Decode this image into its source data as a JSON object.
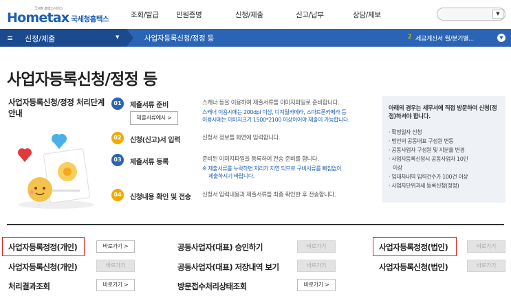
{
  "header": {
    "logo_small": "국세청 홈택스서비스",
    "logo_text": "Hometax",
    "logo_kr": "국세청홈택스",
    "nav": [
      "조회/발급",
      "민원증명",
      "신청/제출",
      "신고/납부",
      "상담/제보"
    ],
    "search_button_icon": "chevron-down-icon"
  },
  "subnav": {
    "section": "신청/제출",
    "breadcrumb": "사업자등록신청/정정 등",
    "notice_num": "2",
    "notice_text": "세금계산서 월/분기별..."
  },
  "page": {
    "title": "사업자등록신청/정정 등",
    "guide_title": "사업자등록신청/정정 처리단계 안내"
  },
  "steps": [
    {
      "num": "01",
      "title": "제출서류 준비",
      "desc": "스캐너 등을 이용하여 제출서류를 이미지파일로 준비합니다.",
      "note1": "스캐너 이용시에는 200dpi 이상, 디지털카메라, 스마트폰카메라 등",
      "note2": "이용시에는 이미지크기 1500*2100 이상이어야 제출이 가능합니다.",
      "button": "제출서류예시 >",
      "color": "#2b64b4"
    },
    {
      "num": "02",
      "title": "신청(신고)서 입력",
      "desc": "신청서 정보를 화면에 입력합니다.",
      "color": "#f2a900"
    },
    {
      "num": "03",
      "title": "제출서류 등록",
      "desc": "준비된 이미지파일을 등록하여 전송 준비를 합니다.",
      "note1": "※ 제출서류를 누락하면 처리가 지연 되므로 구비서류를 빠짐없이",
      "note2": "제출하시기 바랍니다.",
      "color": "#2b64b4"
    },
    {
      "num": "04",
      "title": "신청내용 확인 및 전송",
      "desc": "신청서 입력내용과 제출서류를 최종 확인한 후 전송합니다.",
      "color": "#f2a900"
    }
  ],
  "infobox": {
    "heading": "아래의 경우는 세무서에 직접 방문하여 신청(정정)하셔야 합니다.",
    "items": [
      "· 확정일자 신청",
      "· 법인의 공동대표 구성원 변동",
      "· 공동사업자 구성원 및 지분율 변경",
      "· 사업자등록신청시 공동사업자 10인",
      "  이상",
      "· 임대차내역 입력건수가 100건 이상",
      "· 사업자단위과세 등록신청(정정)"
    ]
  },
  "services": {
    "go_label": "바로가기 >",
    "go_label_disabled": "바로가기",
    "rows": [
      {
        "label": "사업자등록정정(개인)",
        "enabled": true,
        "highlight": true
      },
      {
        "label": "사업자등록신청(개인)",
        "enabled": false
      },
      {
        "label": "처리결과조회",
        "enabled": true
      },
      {
        "label": "공동사업자(대표) 승인하기",
        "enabled": false
      },
      {
        "label": "공동사업자(대표) 저장내역 보기",
        "enabled": false
      },
      {
        "label": "방문접수처리상태조회",
        "enabled": true
      },
      {
        "label": "사업자등록정정(법인)",
        "enabled": false,
        "highlight": true
      },
      {
        "label": "사업자등록신청(법인)",
        "enabled": false
      }
    ]
  },
  "colors": {
    "brand_blue": "#2b64b4",
    "dark_blue": "#1b4a8f",
    "accent": "#f2a900",
    "highlight": "#e02020"
  }
}
